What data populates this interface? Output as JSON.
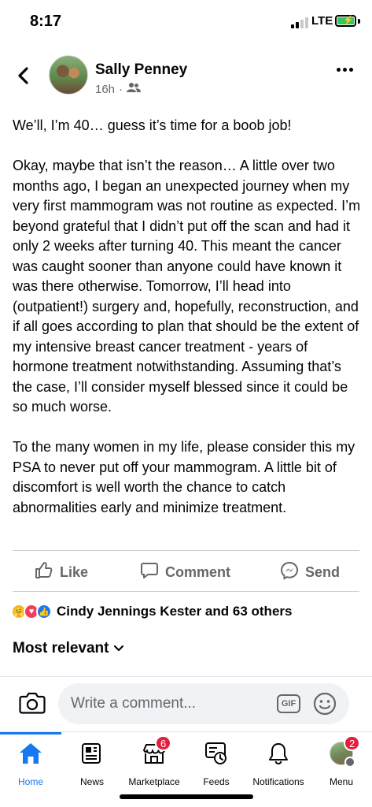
{
  "status_bar": {
    "time": "8:17",
    "network": "LTE"
  },
  "post": {
    "author": "Sally Penney",
    "time_ago": "16h",
    "audience_icon": "friends-icon",
    "paragraphs": [
      "We’ll, I’m 40… guess it’s time for a boob job!",
      "Okay, maybe that isn’t the reason… A little over two months ago, I began an unexpected journey when my very first mammogram was not routine as expected. I’m beyond grateful that I didn’t put off the scan and had it only 2 weeks after turning 40. This meant the cancer was caught sooner than anyone could have known it was there otherwise. Tomorrow, I’ll head into (outpatient!) surgery and, hopefully, reconstruction, and if all goes according to plan that should be the extent of my intensive breast cancer treatment - years of hormone treatment notwithstanding.  Assuming that’s the case, I’ll consider myself blessed since it could be so much worse.",
      "To the many women in my life, please consider this my PSA to never put off your mammogram. A little bit of discomfort is well worth the chance to catch abnormalities early and minimize treatment."
    ]
  },
  "actions": {
    "like": "Like",
    "comment": "Comment",
    "send": "Send"
  },
  "reactions": {
    "summary": "Cindy Jennings Kester and 63 others",
    "types": [
      "care",
      "love",
      "like"
    ]
  },
  "comments": {
    "sort_label": "Most relevant"
  },
  "comment_bar": {
    "placeholder": "Write a comment...",
    "gif_label": "GIF"
  },
  "tabbar": {
    "items": [
      {
        "label": "Home",
        "active": true
      },
      {
        "label": "News"
      },
      {
        "label": "Marketplace",
        "badge": "6"
      },
      {
        "label": "Feeds"
      },
      {
        "label": "Notifications"
      },
      {
        "label": "Menu",
        "badge": "2"
      }
    ]
  },
  "colors": {
    "accent": "#1877f2",
    "badge": "#e41e3f",
    "secondary_text": "#65676b"
  }
}
